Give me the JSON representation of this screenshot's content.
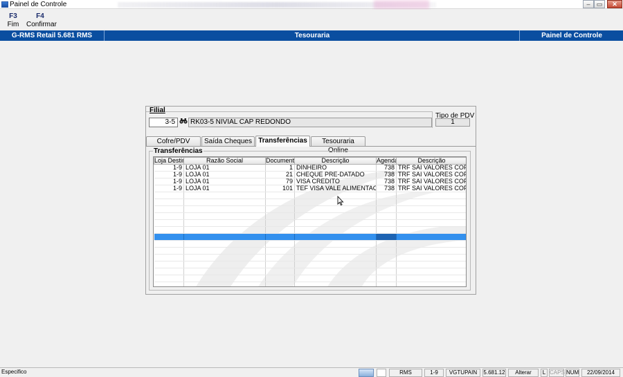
{
  "window": {
    "title": "Painel de Controle"
  },
  "toolbar": {
    "f3": {
      "key": "F3",
      "label": "Fim"
    },
    "f4": {
      "key": "F4",
      "label": "Confirmar"
    }
  },
  "header": {
    "left": "G-RMS Retail 5.681 RMS",
    "center": "Tesouraria",
    "right": "Painel de Controle"
  },
  "filial": {
    "label": "Filial",
    "number": "3-5",
    "name": "RK03-5 NIVIAL CAP REDONDO",
    "tipo_pdv_label": "Tipo de PDV",
    "tipo_pdv_value": "1"
  },
  "tabs": [
    {
      "label": "Cofre/PDV",
      "active": false
    },
    {
      "label": "Saída Cheques",
      "active": false
    },
    {
      "label": "Transferências",
      "active": true
    },
    {
      "label": "Tesouraria Online",
      "active": false
    }
  ],
  "group": {
    "label": "Transferências"
  },
  "grid": {
    "columns": [
      "Loja Destino",
      "Razão Social",
      "Documento",
      "Descrição",
      "Agenda",
      "Descrição"
    ],
    "rows": [
      [
        "1-9",
        "LOJA 01",
        "1",
        "DINHEIRO",
        "738",
        "TRF SAI VALORES COFRE"
      ],
      [
        "1-9",
        "LOJA 01",
        "21",
        "CHEQUE PRE-DATADO",
        "738",
        "TRF SAI VALORES COFRE"
      ],
      [
        "1-9",
        "LOJA 01",
        "79",
        "VISA CREDITO",
        "738",
        "TRF SAI VALORES COFRE"
      ],
      [
        "1-9",
        "LOJA 01",
        "101",
        "TEF VISA VALE ALIMENTACAO",
        "738",
        "TRF SAI VALORES COFRE"
      ]
    ]
  },
  "statusbar": {
    "mode": "Especifico",
    "system": "RMS",
    "filial": "1-9",
    "program": "VGTUPAIN",
    "version": "5.681.12",
    "action": "Alterar",
    "l": "L",
    "caps": "CAPS",
    "num": "NUM",
    "date": "22/09/2014"
  }
}
